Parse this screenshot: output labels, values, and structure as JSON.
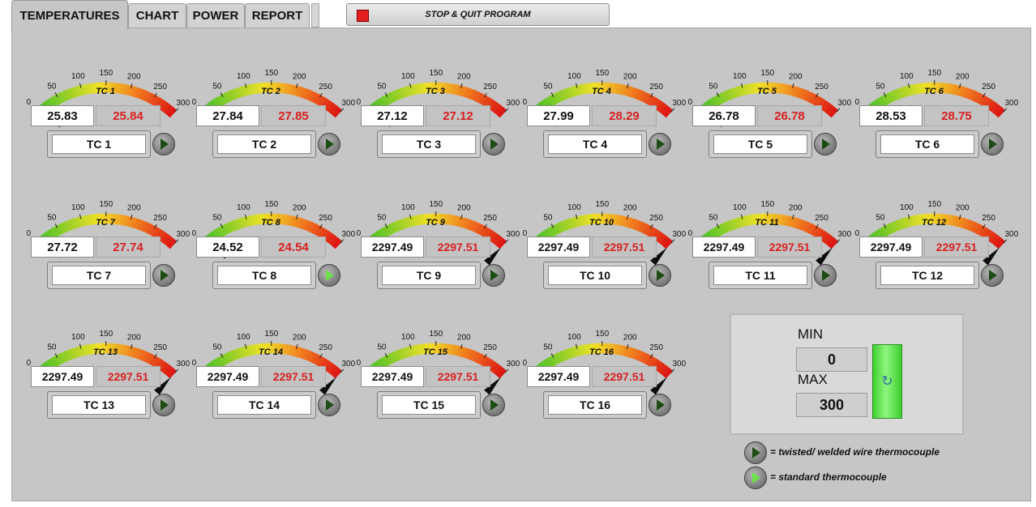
{
  "tabs": [
    "TEMPERATURES",
    "CHART",
    "POWER",
    "REPORT"
  ],
  "stop_button": {
    "label": "STOP & QUIT PROGRAM"
  },
  "gauge": {
    "ticks": [
      "0",
      "50",
      "100",
      "150",
      "200",
      "250",
      "300"
    ],
    "min": 0,
    "max": 300
  },
  "thermocouples": [
    {
      "gauge_label": "TC 1",
      "value": "25.83",
      "display": "25.84",
      "button_label": "TC 1",
      "reading": 25.83,
      "type": "twisted"
    },
    {
      "gauge_label": "TC 2",
      "value": "27.84",
      "display": "27.85",
      "button_label": "TC 2",
      "reading": 27.84,
      "type": "twisted"
    },
    {
      "gauge_label": "TC 3",
      "value": "27.12",
      "display": "27.12",
      "button_label": "TC 3",
      "reading": 27.12,
      "type": "twisted"
    },
    {
      "gauge_label": "TC 4",
      "value": "27.99",
      "display": "28.29",
      "button_label": "TC 4",
      "reading": 27.99,
      "type": "twisted"
    },
    {
      "gauge_label": "TC 5",
      "value": "26.78",
      "display": "26.78",
      "button_label": "TC 5",
      "reading": 26.78,
      "type": "twisted"
    },
    {
      "gauge_label": "TC 6",
      "value": "28.53",
      "display": "28.75",
      "button_label": "TC 6",
      "reading": 28.53,
      "type": "twisted"
    },
    {
      "gauge_label": "TC 7",
      "value": "27.72",
      "display": "27.74",
      "button_label": "TC 7",
      "reading": 27.72,
      "type": "twisted"
    },
    {
      "gauge_label": "TC 8",
      "value": "24.52",
      "display": "24.54",
      "button_label": "TC 8",
      "reading": 24.52,
      "type": "standard"
    },
    {
      "gauge_label": "TC 9",
      "value": "2297.49",
      "display": "2297.51",
      "button_label": "TC 9",
      "reading": 2297.49,
      "type": "twisted"
    },
    {
      "gauge_label": "TC 10",
      "value": "2297.49",
      "display": "2297.51",
      "button_label": "TC 10",
      "reading": 2297.49,
      "type": "twisted"
    },
    {
      "gauge_label": "TC 11",
      "value": "2297.49",
      "display": "2297.51",
      "button_label": "TC 11",
      "reading": 2297.49,
      "type": "twisted"
    },
    {
      "gauge_label": "TC 12",
      "value": "2297.49",
      "display": "2297.51",
      "button_label": "TC 12",
      "reading": 2297.49,
      "type": "twisted"
    },
    {
      "gauge_label": "TC 13",
      "value": "2297.49",
      "display": "2297.51",
      "button_label": "TC 13",
      "reading": 2297.49,
      "type": "twisted"
    },
    {
      "gauge_label": "TC 14",
      "value": "2297.49",
      "display": "2297.51",
      "button_label": "TC 14",
      "reading": 2297.49,
      "type": "twisted"
    },
    {
      "gauge_label": "TC 15",
      "value": "2297.49",
      "display": "2297.51",
      "button_label": "TC 15",
      "reading": 2297.49,
      "type": "twisted"
    },
    {
      "gauge_label": "TC 16",
      "value": "2297.49",
      "display": "2297.51",
      "button_label": "TC 16",
      "reading": 2297.49,
      "type": "twisted"
    }
  ],
  "scale_panel": {
    "min_label": "MIN",
    "min_value": "0",
    "max_label": "MAX",
    "max_value": "300",
    "apply_icon": "refresh-icon"
  },
  "legend": [
    {
      "type": "twisted",
      "text": "= twisted/ welded wire thermocouple"
    },
    {
      "type": "standard",
      "text": "= standard thermocouple"
    }
  ],
  "colors": {
    "panel": "#c6c6c6",
    "red_value": "#d92020",
    "led_green": "#6ce04a",
    "led_dark": "#1d4d15",
    "stop_led": "#e41d1d"
  }
}
